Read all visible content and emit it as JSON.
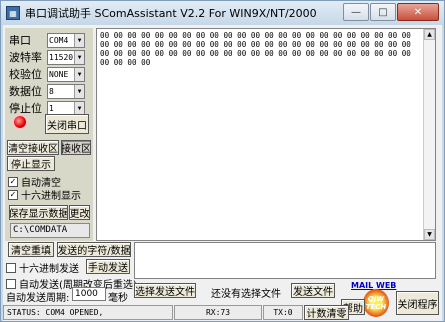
{
  "window": {
    "title": "串口调试助手 SComAssistant V2.2 For WIN9X/NT/2000",
    "minimize_glyph": "—",
    "maximize_glyph": "□",
    "close_glyph": "✕"
  },
  "settings": {
    "port_label": "串口",
    "port_value": "COM4",
    "baud_label": "波特率",
    "baud_value": "11520",
    "parity_label": "校验位",
    "parity_value": "NONE",
    "databits_label": "数据位",
    "databits_value": "8",
    "stopbits_label": "停止位",
    "stopbits_value": "1"
  },
  "controls": {
    "close_port": "关闭串口",
    "clear_receive": "清空接收区",
    "receive_area": "接收区",
    "stop_display": "停止显示",
    "auto_clear": "自动清空",
    "hex_display": "十六进制显示",
    "save_data": "保存显示数据",
    "change": "更改",
    "save_path": "C:\\COMDATA"
  },
  "receive": {
    "text": "00 00 00 00 00 00 00 00 00 00 00 00 00 00 00 00 00 00 00 00 00 00 00 00 00 00 00 00 00 00 00 00 00 00 00 00 00 00 00 00 00 00 00 00 00 00 00 00 00 00 00 00 00 00 00 00 00 00 00 00 00 00 00 00 00 00 00 00 00 00 00 00 00"
  },
  "send": {
    "clear_resend": "清空重填",
    "send_chars": "发送的字符/数据",
    "hex_send": "十六进制发送",
    "manual_send": "手动发送",
    "auto_send": "自动发送(周期改变后重选)",
    "period_label": "自动发送周期:",
    "period_value": "1000",
    "period_unit": "毫秒",
    "select_file": "选择发送文件",
    "no_file": "还没有选择文件",
    "send_file": "发送文件",
    "help": "帮助",
    "close_app": "关闭程序",
    "count_clear": "计数清零",
    "mail_link": "MAIL",
    "web_link": "WEB",
    "logo_line1": "QJW",
    "logo_line2": "TECH"
  },
  "status": {
    "port_status": "STATUS: COM4 OPENED,",
    "rx": "RX:73",
    "tx": "TX:0"
  }
}
